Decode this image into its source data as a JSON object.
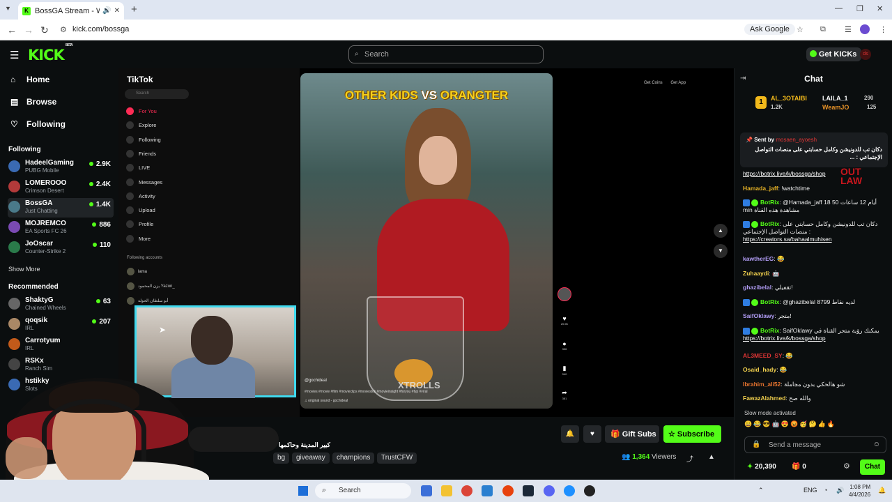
{
  "browser": {
    "tab_title": "BossGA Stream - Watch Liv",
    "url": "kick.com/bossga",
    "ask_google": "Ask Google"
  },
  "header": {
    "logo": "KICK",
    "logo_badge": "BETA",
    "search_placeholder": "Search",
    "get_kicks": "Get KICKs",
    "user_initials": "ds"
  },
  "sidebar": {
    "nav": [
      {
        "label": "Home"
      },
      {
        "label": "Browse"
      },
      {
        "label": "Following"
      }
    ],
    "following_heading": "Following",
    "following": [
      {
        "name": "HadeelGaming",
        "game": "PUBG Mobile",
        "viewers": "2.9K",
        "color": "#3a6ab3"
      },
      {
        "name": "LOMEROOO",
        "game": "Crimson Desert",
        "viewers": "2.4K",
        "color": "#b33a3a"
      },
      {
        "name": "BossGA",
        "game": "Just Chatting",
        "viewers": "1.4K",
        "color": "#4a7a8a"
      },
      {
        "name": "MOJREMCO",
        "game": "EA Sports FC 26",
        "viewers": "886",
        "color": "#7a4ab3"
      },
      {
        "name": "JoOscar",
        "game": "Counter-Strike 2",
        "viewers": "110",
        "color": "#2a7a4a"
      }
    ],
    "show_more": "Show More",
    "recommended_heading": "Recommended",
    "recommended": [
      {
        "name": "ShaktyG",
        "game": "Chained Wheels",
        "viewers": "63",
        "color": "#666"
      },
      {
        "name": "qoqsik",
        "game": "IRL",
        "viewers": "207",
        "color": "#aa8866"
      },
      {
        "name": "Carrotyum",
        "game": "IRL",
        "viewers": "",
        "color": "#c25a1a"
      },
      {
        "name": "RSKx",
        "game": "Ranch Sim",
        "viewers": "",
        "color": "#444"
      },
      {
        "name": "hstikky",
        "game": "Slots",
        "viewers": "",
        "color": "#3a6ab3"
      }
    ]
  },
  "tiktok": {
    "logo": "TikTok",
    "search": "Search",
    "nav": [
      "For You",
      "Explore",
      "Following",
      "Friends",
      "LIVE",
      "Messages",
      "Activity",
      "Upload",
      "Profile",
      "More"
    ],
    "following_accounts": "Following accounts",
    "accounts": [
      "lama",
      "يزن المحمود Yazon_",
      "أبو سلطان الحوله"
    ],
    "top_buttons": [
      "Get Coins",
      "Get App"
    ],
    "video_title_1": "OTHER KIDS ",
    "video_title_2": "VS",
    "video_title_3": " ORANGTER",
    "watermark": "XTROLLS",
    "handle": "@gochideal",
    "hashtags": "#movies #movie #film #movieclips #moviestok #movieinsight #foryou #fyp #viral",
    "sound": "♫ original sound - gochideal",
    "rail_counts": [
      "20.6K",
      "336",
      "940",
      "381"
    ]
  },
  "stream_info": {
    "title": "كبير المدينة وحاكمها",
    "tags": [
      "bg",
      "giveaway",
      "champions",
      "TrustCFW"
    ],
    "gift_subs": "Gift Subs",
    "subscribe": "Subscribe",
    "viewers": "1,364",
    "viewers_label": " Viewers"
  },
  "chat": {
    "title": "Chat",
    "leaderboard": [
      {
        "rank": "1",
        "name": "AL_3OTAIBI",
        "count": "1.2K"
      },
      {
        "name": "LAILA_1",
        "count": "290"
      },
      {
        "name": "WeamJO",
        "count": "125"
      }
    ],
    "pinned_sent_by": "Sent by",
    "pinned_user": "mosaen_ayoesh",
    "pinned_message": "دكان تب للدونيشن وكامل حسابتي على منصات التواصل الإجتماعي : ...",
    "overlay_brand_1": "OUT",
    "overlay_brand_2": "LAW",
    "messages": [
      {
        "user": "",
        "text": "",
        "link": "https://botrix.live/k/bossga/shop",
        "color": "#fff"
      },
      {
        "user": "Hamada_jaff",
        "text": " !watchtime",
        "link": "",
        "color": "#e7b326"
      },
      {
        "user": "BotRix",
        "text": " @Hamada_jaff 18 أيام 12 ساعات 50 min مشاهدة هذه القناة",
        "link": "",
        "color": "#53fc18"
      },
      {
        "user": "BotRix",
        "text": " دكان تب للدونيشن وكامل حسابتي على منصات التواصل الإجتماعي :",
        "link": "https://creators.sa/bahaalmuhisen",
        "color": "#53fc18"
      },
      {
        "user": "kawtherEG",
        "text": " 😂",
        "link": "",
        "color": "#b29df6"
      },
      {
        "user": "Zuhaaydi",
        "text": " 🤖",
        "link": "",
        "color": "#f2d14e"
      },
      {
        "user": "ghazibelal",
        "text": " تقفيلي!",
        "link": "",
        "color": "#b29df6"
      },
      {
        "user": "BotRix",
        "text": " @ghazibelal لديه نقاط 8799",
        "link": "",
        "color": "#53fc18"
      },
      {
        "user": "SaifOklawy",
        "text": " متجر!",
        "link": "",
        "color": "#b29df6"
      },
      {
        "user": "BotRix",
        "text": " SaifOklawy يمكنك رؤية متجر القناة في",
        "link": "https://botrix.live/k/bossga/shop",
        "color": "#53fc18"
      },
      {
        "user": "AL3MEED_SY",
        "text": " 😂",
        "link": "",
        "color": "#e03535"
      },
      {
        "user": "Osaid_hady",
        "text": " 😂",
        "link": "",
        "color": "#f2d14e"
      },
      {
        "user": "Ibrahim_ali52",
        "text": " شو هالحكي بدون مجاملة",
        "link": "",
        "color": "#e7732e"
      },
      {
        "user": "FawazAlahmed",
        "text": " والله صح",
        "link": "",
        "color": "#f2d14e"
      }
    ],
    "slow_mode": "Slow mode activated",
    "send_placeholder": "Send a message",
    "kicks_balance": "20,390",
    "gifts_balance": "0",
    "chat_button": "Chat"
  },
  "taskbar": {
    "search": "Search",
    "lang": "ENG",
    "time": "1:08 PM",
    "date": "4/4/2026"
  }
}
